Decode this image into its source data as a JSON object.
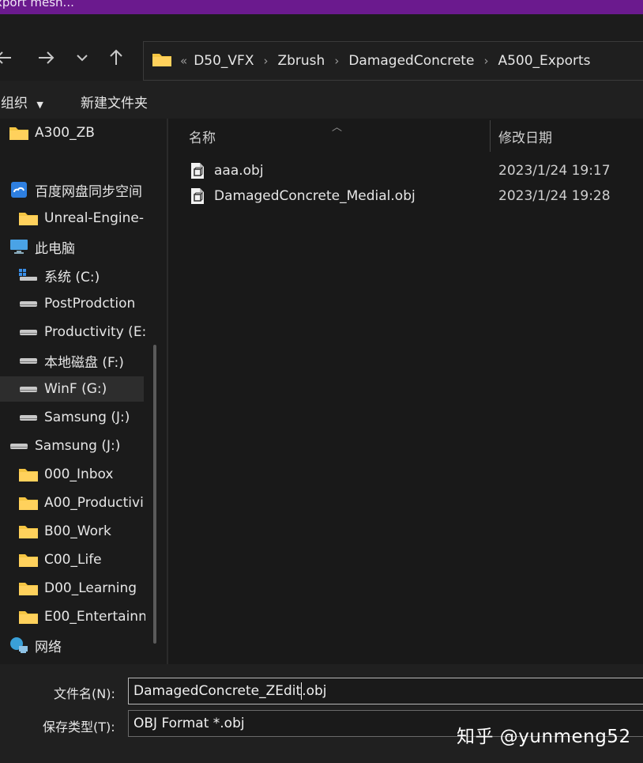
{
  "window": {
    "title": "xport mesh..."
  },
  "nav": {
    "back_icon": "arrow-left-icon",
    "forward_icon": "arrow-right-icon",
    "recent_icon": "chevron-down-icon",
    "up_icon": "arrow-up-icon"
  },
  "address": {
    "overflow": "«",
    "crumbs": [
      "D50_VFX",
      "Zbrush",
      "DamagedConcrete",
      "A500_Exports"
    ]
  },
  "toolbar": {
    "organize": "组织",
    "new_folder": "新建文件夹"
  },
  "sidebar": {
    "items": [
      {
        "label": "A300_ZB",
        "icon": "folder-icon"
      },
      {
        "label": "百度网盘同步空间",
        "icon": "cloud-drive-icon"
      },
      {
        "label": "Unreal-Engine-",
        "icon": "folder-icon"
      },
      {
        "label": "此电脑",
        "icon": "computer-icon"
      },
      {
        "label": "系统 (C:)",
        "icon": "system-drive-icon"
      },
      {
        "label": "PostProdction",
        "icon": "drive-icon"
      },
      {
        "label": "Productivity (E:",
        "icon": "drive-icon"
      },
      {
        "label": "本地磁盘 (F:)",
        "icon": "drive-icon"
      },
      {
        "label": "WinF (G:)",
        "icon": "drive-icon"
      },
      {
        "label": "Samsung (J:)",
        "icon": "drive-icon"
      },
      {
        "label": "Samsung (J:)",
        "icon": "drive-icon"
      },
      {
        "label": "000_Inbox",
        "icon": "folder-icon"
      },
      {
        "label": "A00_Productivi",
        "icon": "folder-icon"
      },
      {
        "label": "B00_Work",
        "icon": "folder-icon"
      },
      {
        "label": "C00_Life",
        "icon": "folder-icon"
      },
      {
        "label": "D00_Learning",
        "icon": "folder-icon"
      },
      {
        "label": "E00_Entertainn",
        "icon": "folder-icon"
      },
      {
        "label": "网络",
        "icon": "network-icon"
      }
    ]
  },
  "files": {
    "headers": {
      "name": "名称",
      "modified": "修改日期"
    },
    "rows": [
      {
        "name": "aaa.obj",
        "date": "2023/1/24 19:17"
      },
      {
        "name": "DamagedConcrete_Medial.obj",
        "date": "2023/1/24 19:28"
      }
    ]
  },
  "footer": {
    "filename_label": "文件名(N):",
    "filename_value_a": "DamagedConcrete_ZEdit",
    "filename_value_b": ".obj",
    "filetype_label": "保存类型(T):",
    "filetype_value": "OBJ Format *.obj"
  },
  "watermark": "知乎 @yunmeng52",
  "colors": {
    "titlebar": "#6b1a8e",
    "folder": "#f5c542",
    "background": "#191919",
    "sidebar": "#1b1b1b"
  }
}
